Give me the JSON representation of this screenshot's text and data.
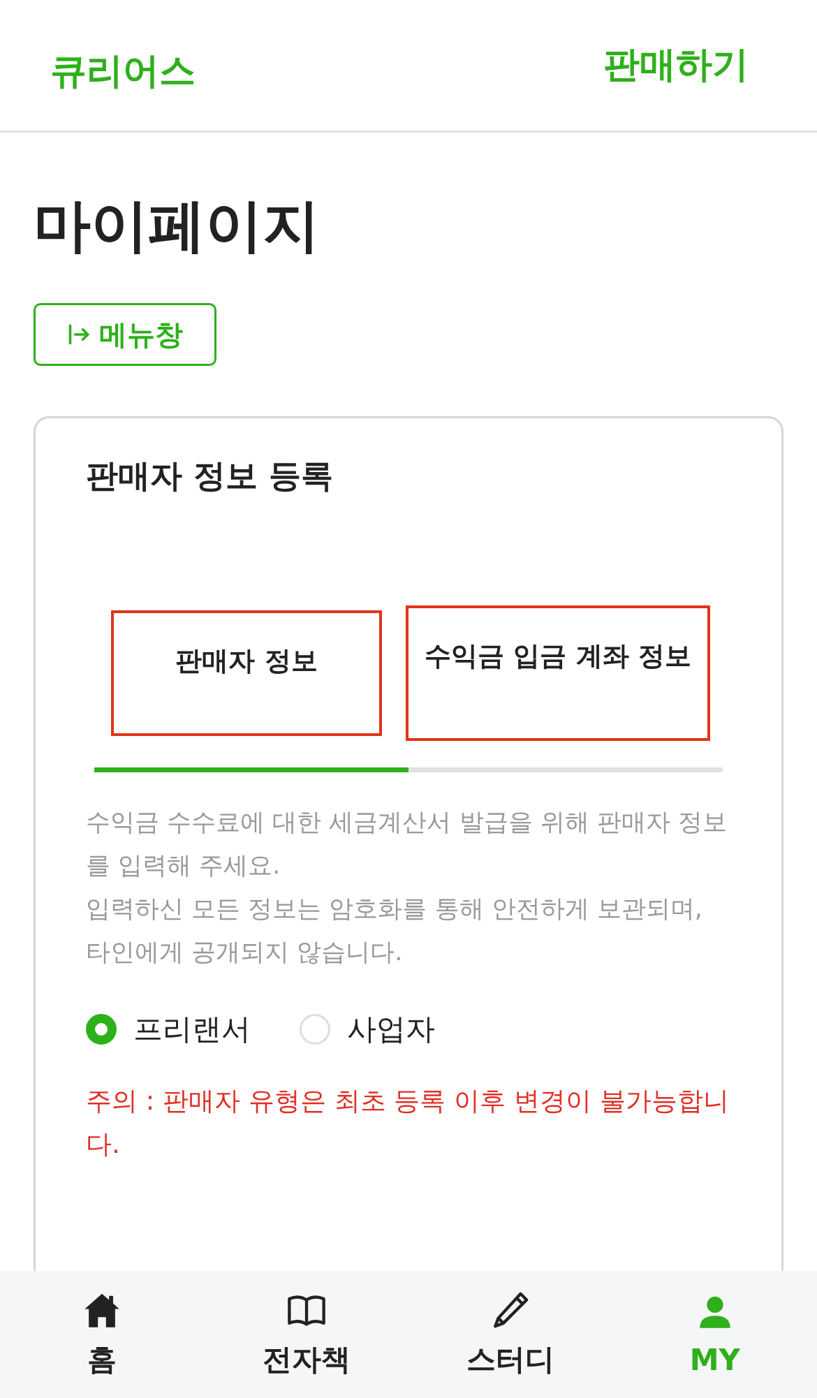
{
  "header": {
    "logo": "큐리어스",
    "sell_link": "판매하기"
  },
  "page_title": "마이페이지",
  "menu_button": {
    "label": "메뉴창"
  },
  "card": {
    "title": "판매자 정보 등록",
    "tabs": [
      {
        "label": "판매자 정보",
        "selected": true
      },
      {
        "label": "수익금 입금 계좌 정보",
        "selected": false
      }
    ],
    "description": [
      "수익금 수수료에 대한 세금계산서 발급을 위해 판매자 정보를 입력해 주세요.",
      "입력하신 모든 정보는 암호화를 통해 안전하게 보관되며, 타인에게 공개되지 않습니다."
    ],
    "seller_types": [
      {
        "label": "프리랜서",
        "selected": true
      },
      {
        "label": "사업자",
        "selected": false
      }
    ],
    "warning": "주의 : 판매자 유형은 최초 등록 이후 변경이 불가능합니다."
  },
  "bottom_nav": [
    {
      "kind": "home",
      "label": "홈",
      "selected": false
    },
    {
      "kind": "book",
      "label": "전자책",
      "selected": false
    },
    {
      "kind": "pencil",
      "label": "스터디",
      "selected": false
    },
    {
      "kind": "person",
      "label": "MY",
      "selected": true
    }
  ]
}
